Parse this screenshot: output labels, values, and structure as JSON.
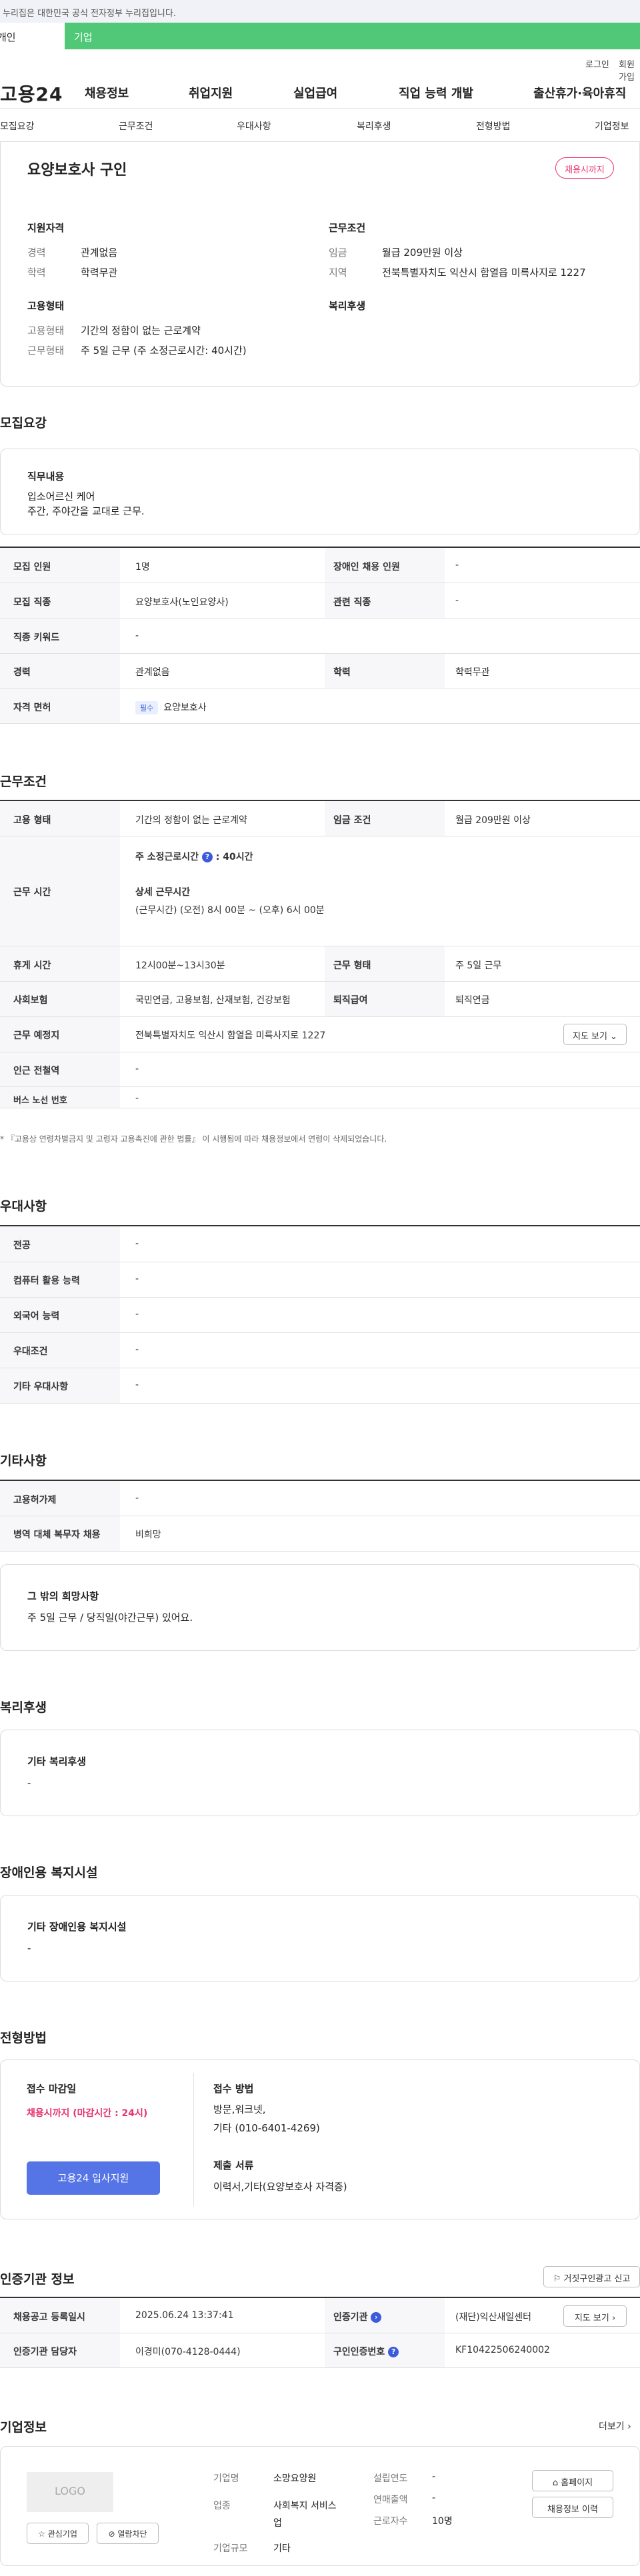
{
  "gov_banner": "이 누리집은 대한민국 공식 전자정부 누리집입니다.",
  "user_tabs": {
    "person": "개인",
    "biz": "기업"
  },
  "util": {
    "login": "로그인",
    "join": "회원가입"
  },
  "logo": "고용24",
  "gnb": [
    "채용정보",
    "취업지원",
    "실업급여",
    "직업 능력 개발",
    "출산휴가·육아휴직"
  ],
  "lnb": [
    "모집요강",
    "근무조건",
    "우대사항",
    "복리후생",
    "전형방법",
    "기업정보"
  ],
  "job": {
    "title": "요양보호사 구인",
    "status": "채용시까지",
    "qual_head": "지원자격",
    "career_k": "경력",
    "career_v": "관계없음",
    "edu_k": "학력",
    "edu_v": "학력무관",
    "emp_head": "고용형태",
    "emptype_k": "고용형태",
    "emptype_v": "기간의 정함이 없는 근로계약",
    "worktype_k": "근무형태",
    "worktype_v": "주 5일 근무 (주 소정근로시간: 40시간)",
    "cond_head": "근무조건",
    "wage_k": "임금",
    "wage_v": "월급 209만원 이상",
    "region_k": "지역",
    "region_v": "전북특별자치도 익산시 함열읍 미륵사지로 1227",
    "welfare_head": "복리후생"
  },
  "recruit": {
    "title": "모집요강",
    "duty_label": "직무내용",
    "duty_lines": [
      "입소어르신 케어",
      "주간, 주야간을 교대로 근무."
    ],
    "rows": {
      "count_k": "모집 인원",
      "count_v": "1명",
      "disabled_k": "장애인 채용 인원",
      "disabled_v": "-",
      "job_k": "모집 직종",
      "job_v": "요양보호사(노인요양사)",
      "related_k": "관련 직종",
      "related_v": "-",
      "keyword_k": "직종 키워드",
      "keyword_v": "-",
      "career_k": "경력",
      "career_v": "관계없음",
      "edu_k": "학력",
      "edu_v": "학력무관",
      "license_k": "자격 면허",
      "license_badge": "필수",
      "license_v": "요양보호사"
    }
  },
  "work": {
    "title": "근무조건",
    "emp_k": "고용 형태",
    "emp_v": "기간의 정함이 없는 근로계약",
    "wage_k": "임금 조건",
    "wage_v": "월급 209만원 이상",
    "hours_k": "근무 시간",
    "hours_week_label": "주 소정근로시간",
    "hours_week_v": ": 40시간",
    "hours_detail_label": "상세 근무시간",
    "hours_detail_v": "(근무시간) (오전) 8시 00분 ~ (오후) 6시 00분",
    "rest_k": "휴게 시간",
    "rest_v": "12시00분~13시30분",
    "form_k": "근무 형태",
    "form_v": "주 5일 근무",
    "insure_k": "사회보험",
    "insure_v": "국민연금, 고용보험, 산재보험, 건강보험",
    "retire_k": "퇴직급여",
    "retire_v": "퇴직연금",
    "place_k": "근무 예정지",
    "place_v": "전북특별자치도 익산시 함열읍 미륵사지로 1227",
    "map_btn": "지도 보기",
    "subway_k": "인근 전철역",
    "subway_v": "-",
    "bus_k": "버스 노선 번호",
    "bus_v": "-",
    "note": "* 『고용상 연령차별금지 및 고령자 고용촉진에 관한 법률』 이 시행됨에 따라 채용정보에서 연령이 삭제되었습니다."
  },
  "prefer": {
    "title": "우대사항",
    "rows": [
      {
        "k": "전공",
        "v": "-"
      },
      {
        "k": "컴퓨터 활용 능력",
        "v": "-"
      },
      {
        "k": "외국어 능력",
        "v": "-"
      },
      {
        "k": "우대조건",
        "v": "-"
      },
      {
        "k": "기타 우대사항",
        "v": "-"
      }
    ]
  },
  "etc": {
    "title": "기타사항",
    "emp_k": "고용허가제",
    "emp_v": "-",
    "mil_k": "병역 대체 복무자 채용",
    "mil_v": "비희망",
    "other_label": "그 밖의 희망사항",
    "other_v": "주 5일 근무 / 당직일(야간근무) 있어요."
  },
  "welfare": {
    "title": "복리후생",
    "label": "기타 복리후생",
    "value": "-"
  },
  "disabled_fac": {
    "title": "장애인용 복지시설",
    "label": "기타 장애인용 복지시설",
    "value": "-"
  },
  "selection": {
    "title": "전형방법",
    "deadline_label": "접수 마감일",
    "deadline_v": "채용시까지 (마감시간 : 24시)",
    "apply_btn": "고용24 입사지원",
    "method_label": "접수 방법",
    "method_lines": [
      "방문,워크넷,",
      "기타 (010-6401-4269)"
    ],
    "docs_label": "제출 서류",
    "docs_v": "이력서,기타(요양보호사 자격증)"
  },
  "cert": {
    "title": "인증기관 정보",
    "report_btn": "거짓구인광고 신고",
    "reg_k": "채용공고 등록일시",
    "reg_v": "2025.06.24 13:37:41",
    "org_k": "인증기관",
    "org_v": "(재단)익산새일센터",
    "map_btn": "지도 보기",
    "mgr_k": "인증기관 담당자",
    "mgr_v": "이경미(070-4128-0444)",
    "no_k": "구인인증번호",
    "no_v": "KF10422506240002"
  },
  "company": {
    "title": "기업정보",
    "more": "더보기",
    "logo_text": "LOGO",
    "interest_btn": "관심기업",
    "block_btn": "열람차단",
    "name_k": "기업명",
    "name_v": "소망요양원",
    "industry_k": "업종",
    "industry_v1": "사회복지 서비스",
    "industry_v2": "업",
    "size_k": "기업규모",
    "size_v": "기타",
    "founded_k": "설립연도",
    "founded_v": "-",
    "sales_k": "연매출액",
    "sales_v": "-",
    "staff_k": "근로자수",
    "staff_v": "10명",
    "homepage_btn": "홈페이지",
    "history_btn": "채용정보 이력"
  },
  "colors": {
    "accent_green": "#50c878",
    "accent_blue": "#5574e6",
    "status_pink": "#e6336b"
  }
}
